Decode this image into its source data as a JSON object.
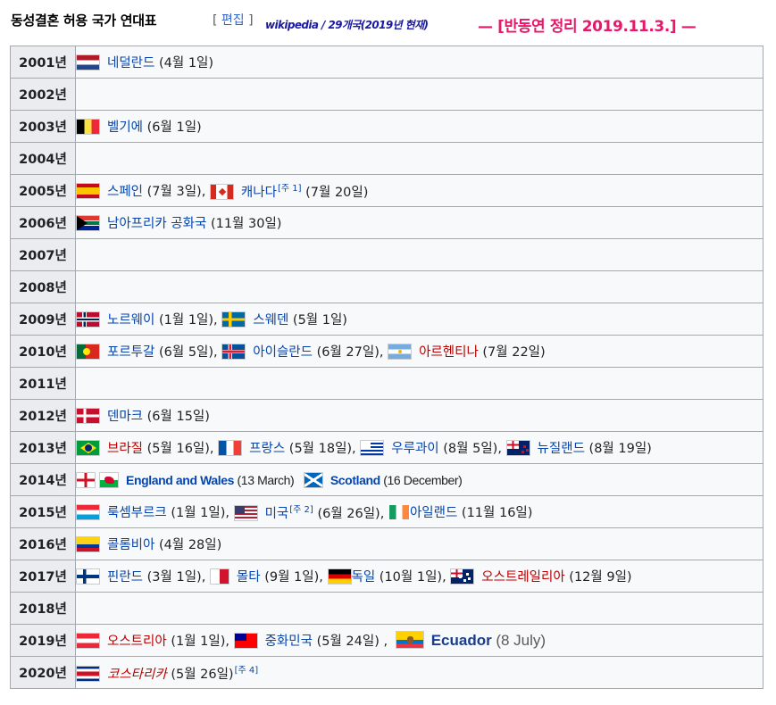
{
  "header": {
    "title": "동성결혼 허용 국가 연대표",
    "edit_open": "[ ",
    "edit_label": "편집",
    "edit_close": " ]",
    "wiki_note": "wikipedia / 29개국(2019년 현재)",
    "editor_note": "— [반동연 정리 2019.11.3.] —"
  },
  "rows": [
    {
      "year": "2001년",
      "entries": [
        {
          "flag": "netherlands-flag",
          "name": "네덜란드",
          "date": "(4월 1일)"
        }
      ]
    },
    {
      "year": "2002년",
      "entries": []
    },
    {
      "year": "2003년",
      "entries": [
        {
          "flag": "belgium-flag",
          "name": "벨기에",
          "date": "(6월 1일)"
        }
      ]
    },
    {
      "year": "2004년",
      "entries": []
    },
    {
      "year": "2005년",
      "entries": [
        {
          "flag": "spain-flag",
          "name": "스페인",
          "date": "(7월 3일),",
          "name_sup": ""
        },
        {
          "flag": "canada-flag",
          "name": "캐나다",
          "note": "[주 1]",
          "date": "(7월 20일)"
        }
      ]
    },
    {
      "year": "2006년",
      "entries": [
        {
          "flag": "south-africa-flag",
          "name": "남아프리카 공화국",
          "date": "(11월 30일)"
        }
      ]
    },
    {
      "year": "2007년",
      "entries": []
    },
    {
      "year": "2008년",
      "entries": []
    },
    {
      "year": "2009년",
      "entries": [
        {
          "flag": "norway-flag",
          "name": "노르웨이",
          "date": "(1월 1일),"
        },
        {
          "flag": "sweden-flag",
          "name": "스웨덴",
          "date": "(5월 1일)"
        }
      ]
    },
    {
      "year": "2010년",
      "entries": [
        {
          "flag": "portugal-flag",
          "name": "포르투갈",
          "date": "(6월 5일),"
        },
        {
          "flag": "iceland-flag",
          "name": "아이슬란드",
          "date": "(6월 27일),"
        },
        {
          "flag": "argentina-flag",
          "name": "아르헨티나",
          "date": "(7월 22일)"
        }
      ]
    },
    {
      "year": "2011년",
      "entries": []
    },
    {
      "year": "2012년",
      "entries": [
        {
          "flag": "denmark-flag",
          "name": "덴마크",
          "date": "(6월 15일)"
        }
      ]
    },
    {
      "year": "2013년",
      "entries": [
        {
          "flag": "brazil-flag",
          "name": "브라질",
          "date": "(5월 16일),"
        },
        {
          "flag": "france-flag",
          "name": "프랑스",
          "date": "(5월 18일),"
        },
        {
          "flag": "uruguay-flag",
          "name": "우루과이",
          "date": "(8월 5일),"
        },
        {
          "flag": "new-zealand-flag",
          "name": "뉴질랜드",
          "date": "(8월 19일)"
        }
      ]
    },
    {
      "year": "2014년",
      "entries": [
        {
          "flag": "england-wales-flags",
          "name": "England and Wales",
          "date": "(13 March)"
        },
        {
          "flag": "scotland-flag",
          "name": "Scotland",
          "date": "(16 December)"
        }
      ]
    },
    {
      "year": "2015년",
      "entries": [
        {
          "flag": "luxembourg-flag",
          "name": "룩셈부르크",
          "date": "(1월 1일),"
        },
        {
          "flag": "usa-flag",
          "name": "미국",
          "note": "[주 2]",
          "date": "(6월 26일),"
        },
        {
          "flag": "ireland-flag",
          "name": "아일랜드",
          "date": "(11월 16일)"
        }
      ]
    },
    {
      "year": "2016년",
      "entries": [
        {
          "flag": "colombia-flag",
          "name": "콜롬비아",
          "date": "(4월 28일)"
        }
      ]
    },
    {
      "year": "2017년",
      "entries": [
        {
          "flag": "finland-flag",
          "name": "핀란드",
          "date": "(3월 1일),"
        },
        {
          "flag": "malta-flag",
          "name": "몰타",
          "date": "(9월 1일),"
        },
        {
          "flag": "germany-flag",
          "name": "독일",
          "date": "(10월 1일),"
        },
        {
          "flag": "australia-flag",
          "name": "오스트레일리아",
          "date": "(12월 9일)"
        }
      ]
    },
    {
      "year": "2018년",
      "entries": []
    },
    {
      "year": "2019년",
      "entries": [
        {
          "flag": "austria-flag",
          "name": "오스트리아",
          "date": "(1월 1일),"
        },
        {
          "flag": "taiwan-flag",
          "name": "중화민국",
          "date": "(5월 24일) ,"
        },
        {
          "flag": "ecuador-flag",
          "name": "Ecuador",
          "date": "(8 July)"
        }
      ]
    },
    {
      "year": "2020년",
      "entries": [
        {
          "flag": "costa-rica-flag",
          "name": "코스타리카",
          "date": "(5월 26일)",
          "note": "[주 4]"
        }
      ]
    }
  ],
  "colors": {
    "year_cell_bg": "#eaecf0",
    "cell_bg": "#f8f9fa",
    "border": "#a2a9b1",
    "link_blue": "#0645ad",
    "link_red": "#ba0000",
    "editor_note_pink": "#e8176a",
    "wiki_note_blue": "#1a1aa6"
  }
}
